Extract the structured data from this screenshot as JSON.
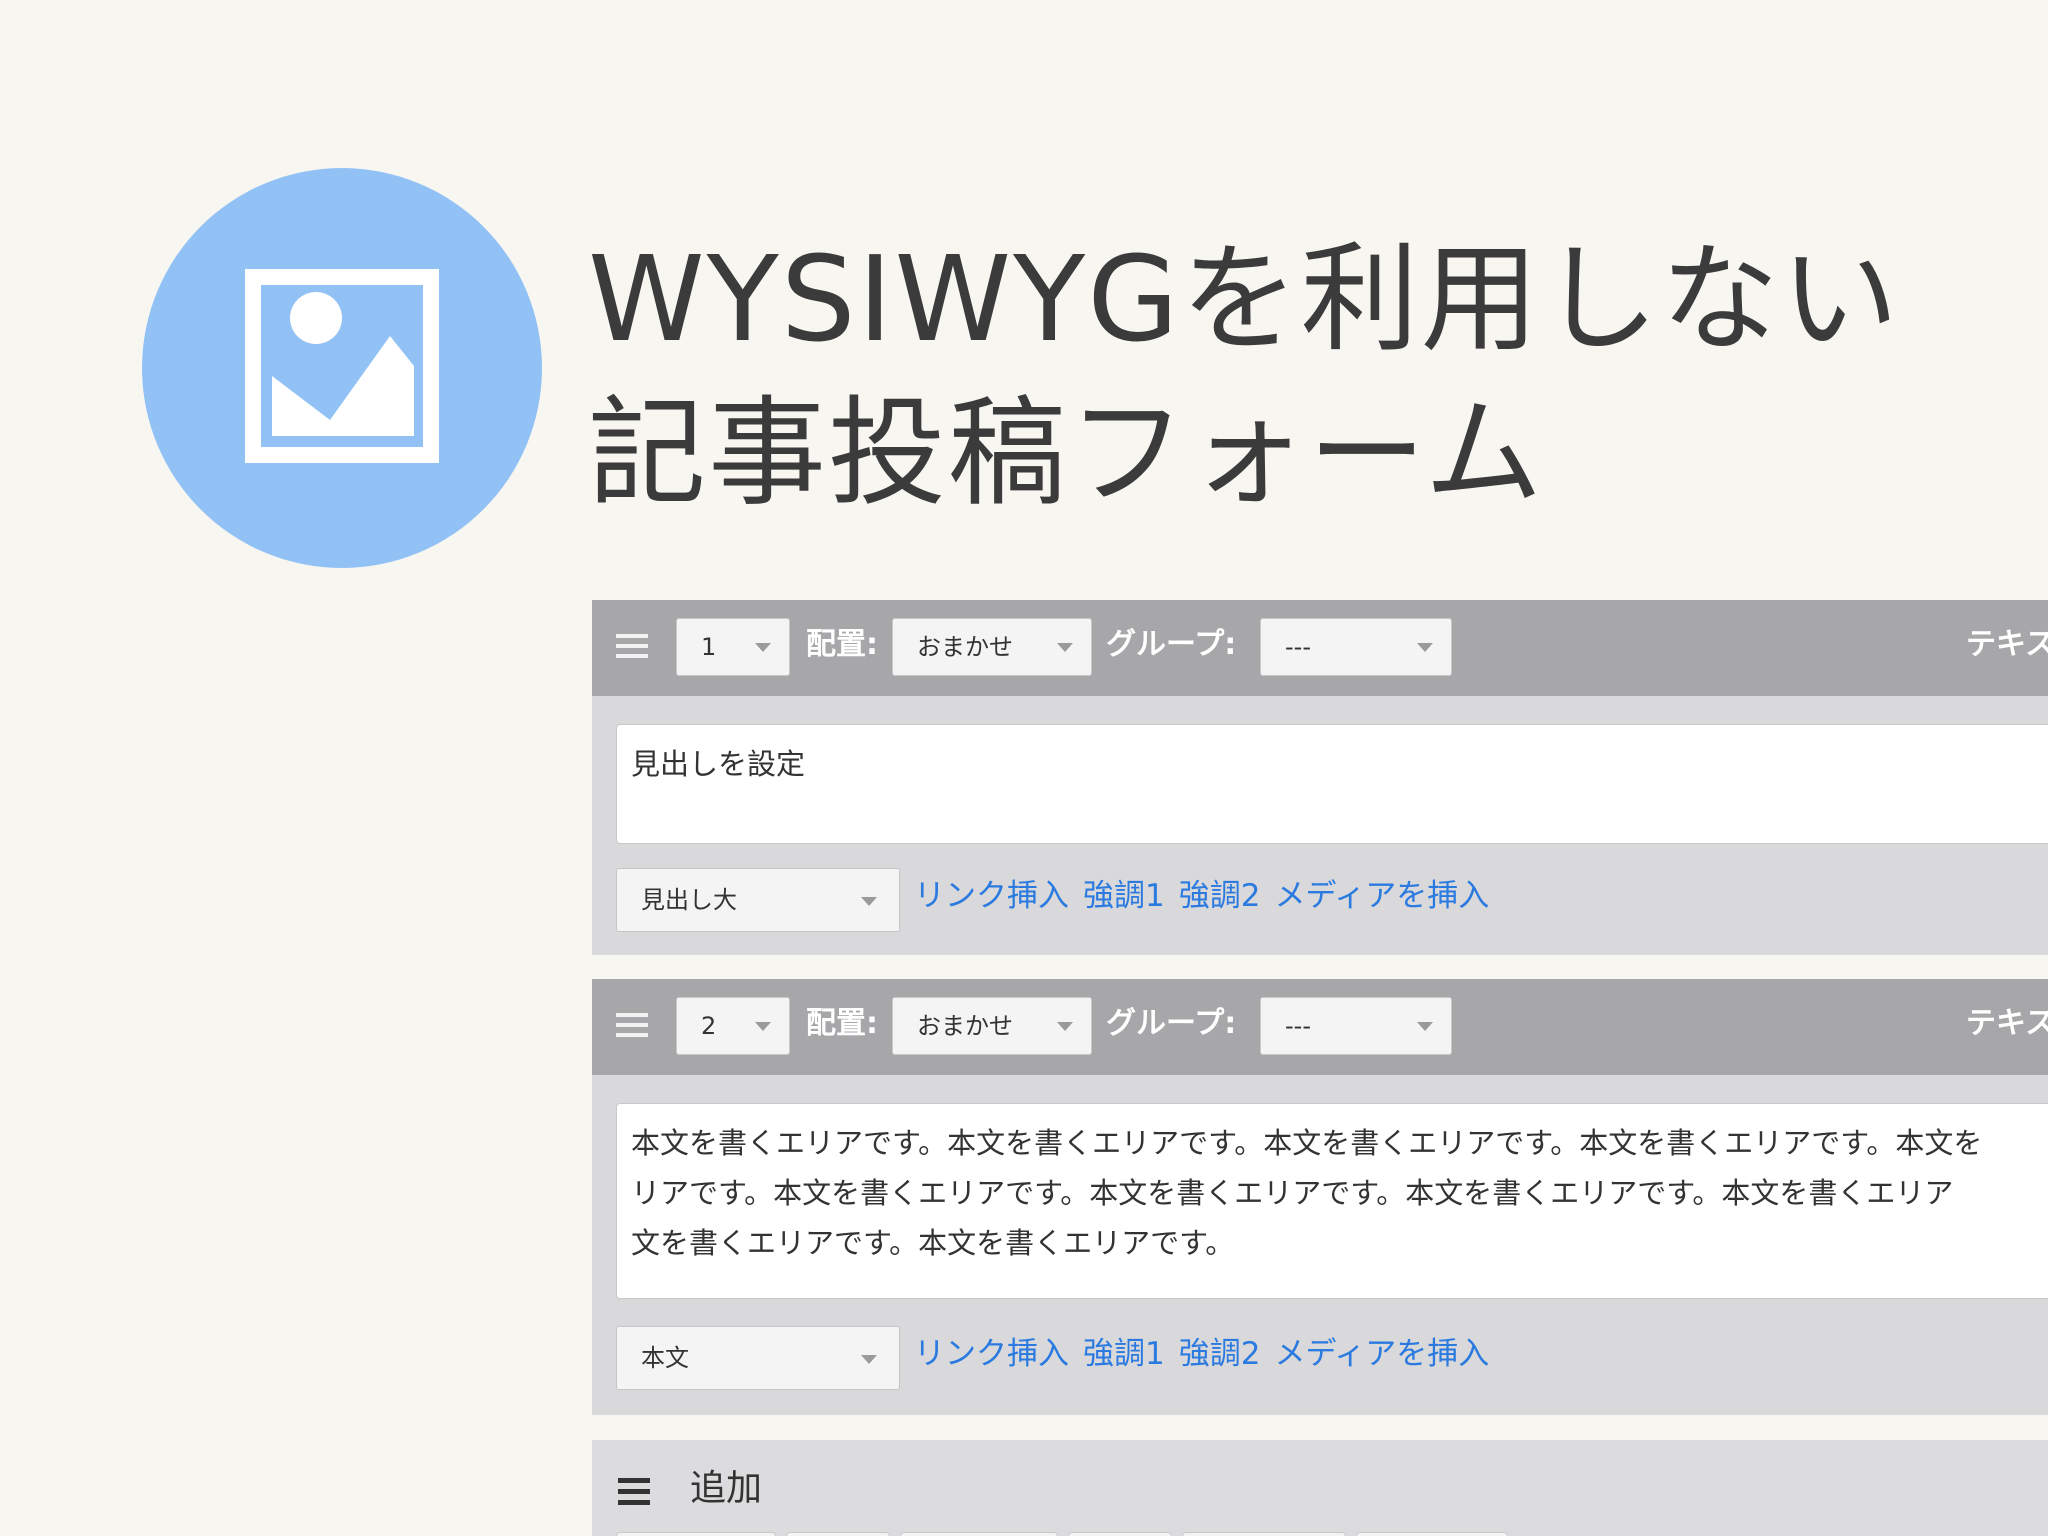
{
  "title": {
    "line1": "WYSIWYGを利用しない",
    "line2": "記事投稿フォーム"
  },
  "units": [
    {
      "order": "1",
      "placement_label": "配置:",
      "placement_value": "おまかせ",
      "group_label": "グループ:",
      "group_value": "---",
      "type_label": "テキス",
      "content": [
        "見出しを設定"
      ],
      "tag": "見出し大",
      "links": [
        "リンク挿入",
        "強調1",
        "強調2",
        "メディアを挿入"
      ]
    },
    {
      "order": "2",
      "placement_label": "配置:",
      "placement_value": "おまかせ",
      "group_label": "グループ:",
      "group_value": "---",
      "type_label": "テキス",
      "content": [
        "本文を書くエリアです。本文を書くエリアです。本文を書くエリアです。本文を書くエリアです。本文を",
        "リアです。本文を書くエリアです。本文を書くエリアです。本文を書くエリアです。本文を書くエリア",
        "文を書くエリアです。本文を書くエリアです。"
      ],
      "tag": "本文",
      "links": [
        "リンク挿入",
        "強調1",
        "強調2",
        "メディアを挿入"
      ]
    }
  ],
  "add": {
    "label": "追加"
  },
  "colors": {
    "background": "#f8f6f1",
    "icon_circle": "#92c2f5",
    "header_bar": "#a7a6a9",
    "unit_body": "#d9d8da",
    "link": "#2a7ae0"
  }
}
